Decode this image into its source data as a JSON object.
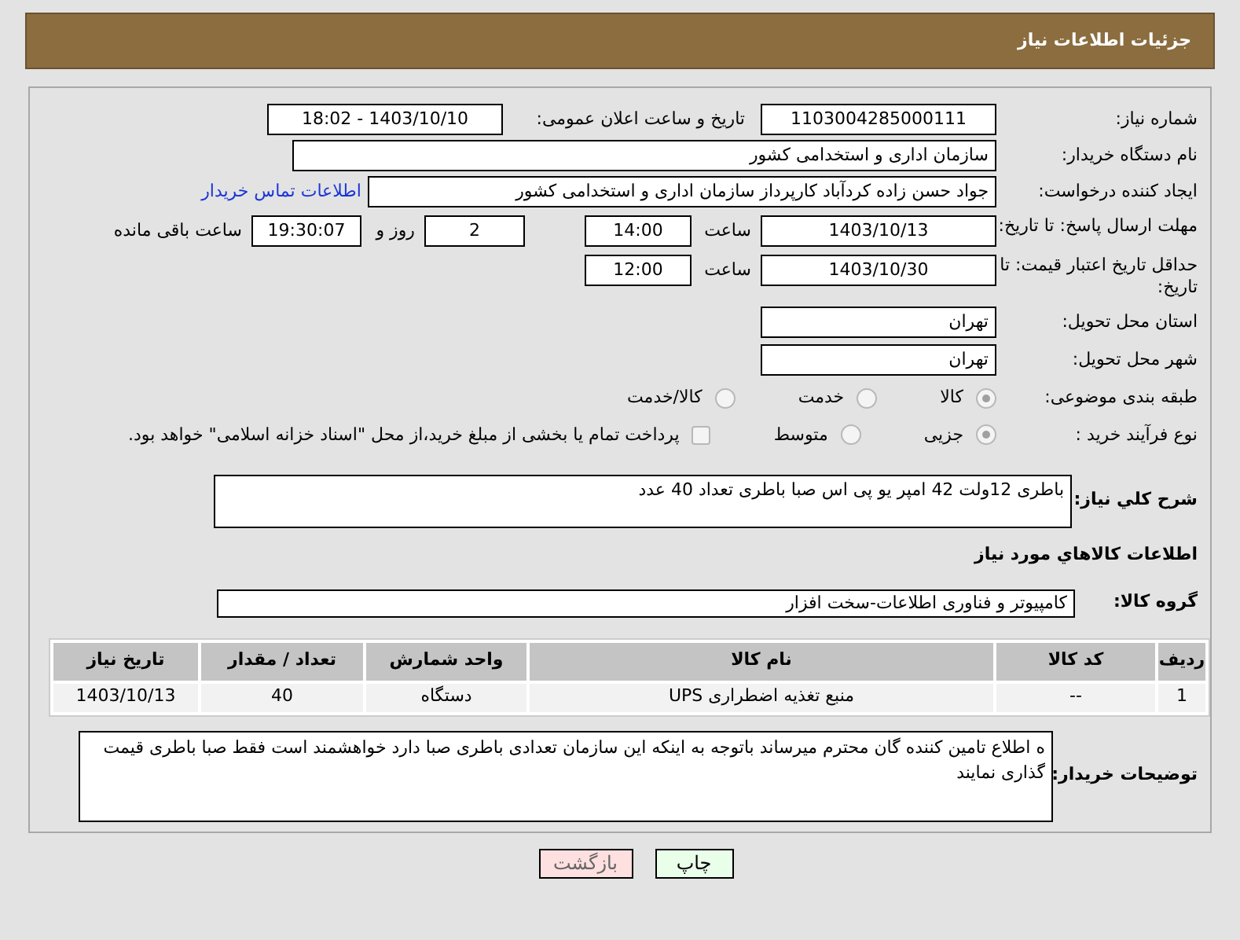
{
  "header": {
    "title": "جزئیات اطلاعات نیاز"
  },
  "need_number": {
    "label": "شماره نیاز:",
    "value": "1103004285000111"
  },
  "announce_date": {
    "label": "تاریخ و ساعت اعلان عمومی:",
    "value": "1403/10/10 - 18:02"
  },
  "buyer_org": {
    "label": "نام دستگاه خریدار:",
    "value": "سازمان اداری و استخدامی کشور"
  },
  "requester": {
    "label": "ایجاد کننده درخواست:",
    "value": "جواد حسن زاده کردآباد کارپرداز سازمان اداری و استخدامی کشور",
    "link": "اطلاعات تماس خریدار"
  },
  "reply_deadline": {
    "label": "مهلت ارسال پاسخ: تا تاریخ:",
    "date": "1403/10/13",
    "time_label": "ساعت",
    "time": "14:00",
    "days": "2",
    "days_label": "روز و",
    "remaining": "19:30:07",
    "remaining_label": "ساعت باقی مانده"
  },
  "price_validity": {
    "label": "حداقل تاریخ اعتبار قیمت: تا تاریخ:",
    "date": "1403/10/30",
    "time_label": "ساعت",
    "time": "12:00"
  },
  "province": {
    "label": "استان محل تحویل:",
    "value": "تهران"
  },
  "city": {
    "label": "شهر محل تحویل:",
    "value": "تهران"
  },
  "category": {
    "label": "طبقه بندی موضوعی:",
    "options": [
      {
        "label": "کالا",
        "selected": true
      },
      {
        "label": "خدمت",
        "selected": false
      },
      {
        "label": "کالا/خدمت",
        "selected": false
      }
    ]
  },
  "process": {
    "label": "نوع فرآیند خرید :",
    "options": [
      {
        "kind": "radio",
        "label": "جزیی",
        "selected": true
      },
      {
        "kind": "radio",
        "label": "متوسط",
        "selected": false
      },
      {
        "kind": "checkbox",
        "label": "پرداخت تمام یا بخشی از مبلغ خرید،از محل \"اسناد خزانه اسلامی\" خواهد بود.",
        "selected": false
      }
    ]
  },
  "description": {
    "label": "شرح کلي نیاز:",
    "value": "باطری 12ولت 42 امپر یو پی اس صبا باطری تعداد 40 عدد"
  },
  "goods_heading": "اطلاعات کالاهاي مورد نیاز",
  "goods_group": {
    "label": "گروه کالا:",
    "value": "کامپیوتر و فناوری اطلاعات-سخت افزار"
  },
  "table": {
    "columns": [
      "ردیف",
      "کد کالا",
      "نام کالا",
      "واحد شمارش",
      "تعداد / مقدار",
      "تاریخ نیاز"
    ],
    "rows": [
      [
        "1",
        "--",
        "منبع تغذیه اضطراری UPS",
        "دستگاه",
        "40",
        "1403/10/13"
      ]
    ]
  },
  "buyer_notes": {
    "label": "توضیحات خریدار:",
    "value": "ه اطلاع تامین کننده گان محترم میرساند باتوجه به اینکه این سازمان تعدادی باطری صبا دارد خواهشمند است فقط صبا باطری قیمت گذاری نمایند"
  },
  "buttons": [
    {
      "kind": "print",
      "label": "چاپ"
    },
    {
      "kind": "back",
      "label": "بازگشت"
    }
  ]
}
